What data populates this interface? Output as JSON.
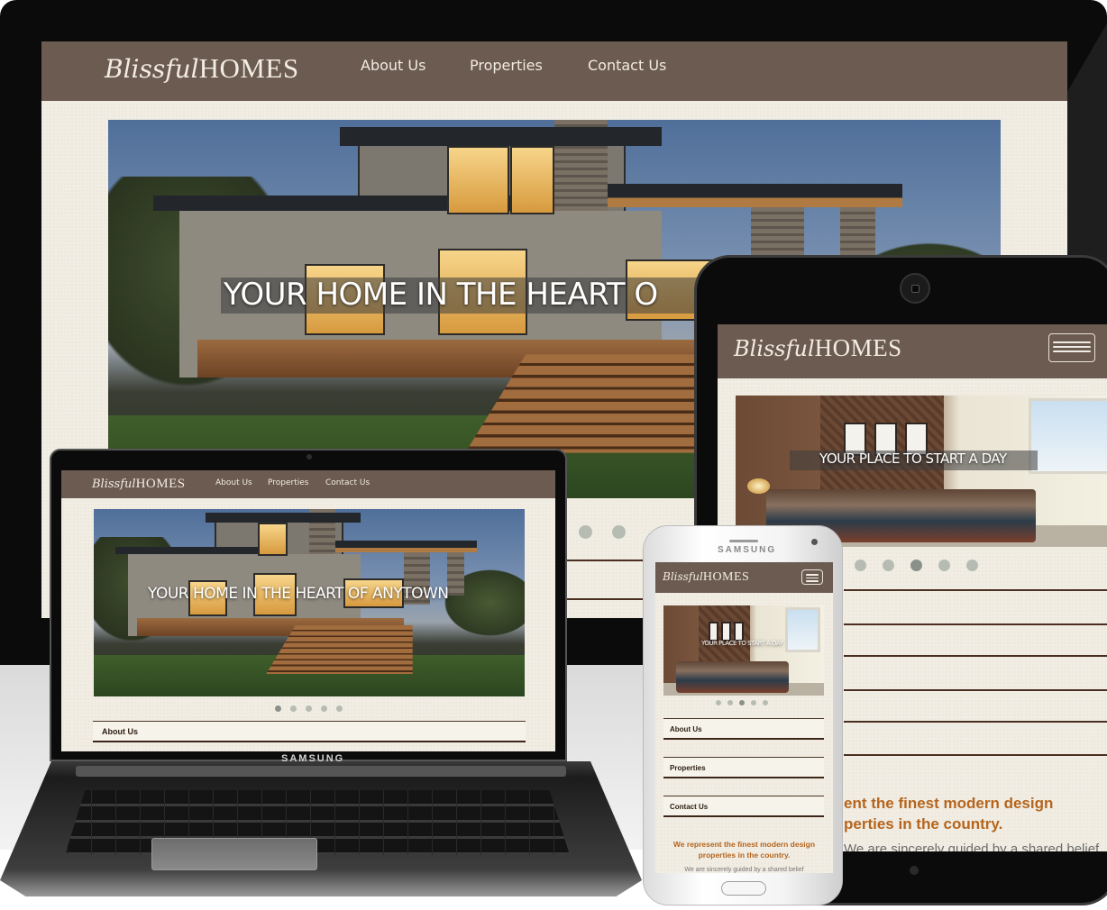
{
  "site": {
    "logo_script": "Blissful",
    "logo_caps": "HOMES",
    "nav": [
      "About Us",
      "Properties",
      "Contact Us"
    ],
    "hero_caption_house": "YOUR HOME IN THE HEART OF ANYTOWN",
    "hero_caption_desktop_visible": "YOUR HOME IN THE HEART O",
    "hero_caption_bedroom": "YOUR PLACE TO START A DAY",
    "sections": [
      "About Us",
      "Properties",
      "Contact Us"
    ],
    "tagline_line1": "We represent the finest modern design",
    "tagline_line2": "properties in the country.",
    "tablet_tagline_line1": "ent the finest modern design",
    "tablet_tagline_line2": "perties in the country.",
    "body_partial": "We are sincerely guided by a shared belief"
  },
  "devices": {
    "laptop_brand": "SAMSUNG",
    "phone_brand": "SAMSUNG"
  },
  "slider": {
    "dot_count": 5,
    "laptop_active_index": 0,
    "tablet_active_index": 3,
    "phone_active_index": 2
  },
  "colors": {
    "header_brown": "#6b5b50",
    "cream": "#f1ede3",
    "tagline_orange": "#b5651d",
    "section_border": "#3c2617"
  },
  "icons": [
    "hamburger-menu-icon",
    "tablet-camera-icon",
    "phone-home-button-icon"
  ]
}
